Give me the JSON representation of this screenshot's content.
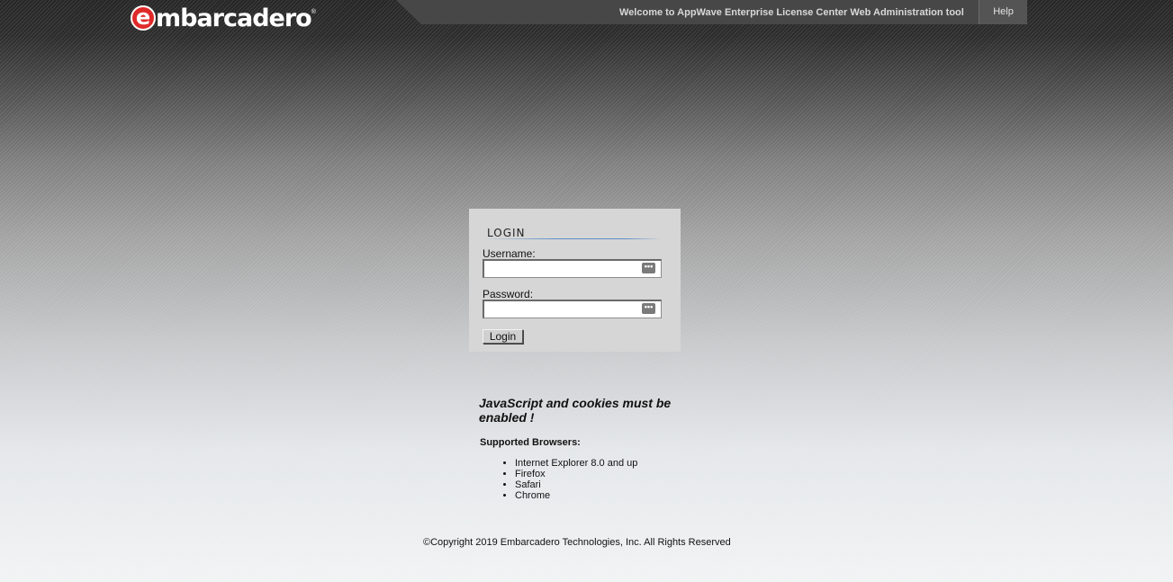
{
  "header": {
    "logo_letter": "e",
    "logo_text": "mbarcadero",
    "logo_reg": "®",
    "welcome": "Welcome to AppWave Enterprise License Center Web Administration tool",
    "help_label": "Help"
  },
  "login": {
    "title": "LOGIN",
    "username_label": "Username:",
    "username_value": "",
    "password_label": "Password:",
    "password_value": "",
    "autofill_icon": "keyboard-dots-icon",
    "autofill_glyph": "•••",
    "button_label": "Login"
  },
  "info": {
    "warning": "JavaScript and cookies must be enabled !",
    "browsers_heading": "Supported Browsers:",
    "browsers": [
      "Internet Explorer 8.0 and up",
      "Firefox",
      "Safari",
      "Chrome"
    ]
  },
  "footer": {
    "copyright": "©Copyright 2019 Embarcadero Technologies, Inc. All Rights Reserved"
  },
  "colors": {
    "logo_red": "#e02a2a",
    "topbar": "#474747",
    "login_panel": "#d6d6d6",
    "title_rule": "#5f8fc8"
  }
}
